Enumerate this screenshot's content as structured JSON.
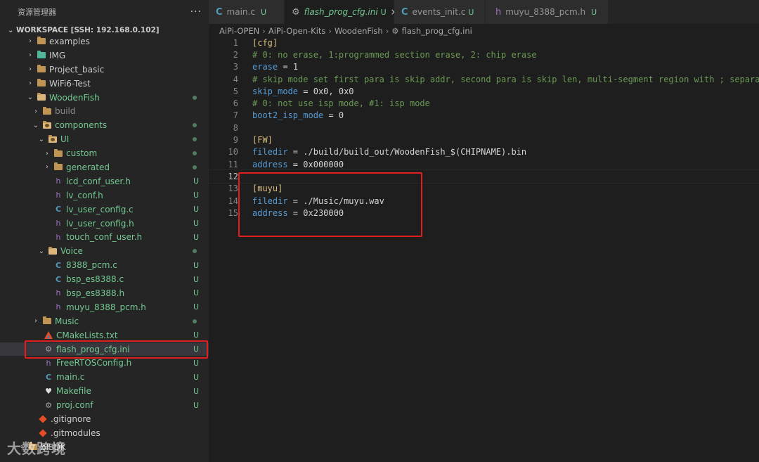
{
  "sidebar": {
    "title": "资源管理器",
    "more": "···",
    "workspace": "WORKSPACE [SSH: 192.168.0.102]",
    "items": [
      {
        "label": "examples",
        "status": ""
      },
      {
        "label": "IMG",
        "status": ""
      },
      {
        "label": "Project_basic",
        "status": ""
      },
      {
        "label": "WiFi6-Test",
        "status": ""
      },
      {
        "label": "WoodenFish",
        "status": ""
      },
      {
        "label": "build",
        "status": ""
      },
      {
        "label": "components",
        "status": ""
      },
      {
        "label": "UI",
        "status": ""
      },
      {
        "label": "custom",
        "status": ""
      },
      {
        "label": "generated",
        "status": ""
      },
      {
        "label": "lcd_conf_user.h",
        "status": "U"
      },
      {
        "label": "lv_conf.h",
        "status": "U"
      },
      {
        "label": "lv_user_config.c",
        "status": "U"
      },
      {
        "label": "lv_user_config.h",
        "status": "U"
      },
      {
        "label": "touch_conf_user.h",
        "status": "U"
      },
      {
        "label": "Voice",
        "status": ""
      },
      {
        "label": "8388_pcm.c",
        "status": "U"
      },
      {
        "label": "bsp_es8388.c",
        "status": "U"
      },
      {
        "label": "bsp_es8388.h",
        "status": "U"
      },
      {
        "label": "muyu_8388_pcm.h",
        "status": "U"
      },
      {
        "label": "Music",
        "status": ""
      },
      {
        "label": "CMakeLists.txt",
        "status": "U"
      },
      {
        "label": "flash_prog_cfg.ini",
        "status": "U"
      },
      {
        "label": "FreeRTOSConfig.h",
        "status": "U"
      },
      {
        "label": "main.c",
        "status": "U"
      },
      {
        "label": "Makefile",
        "status": "U"
      },
      {
        "label": "proj.conf",
        "status": "U"
      },
      {
        "label": ".gitignore",
        "status": ""
      },
      {
        "label": ".gitmodules",
        "status": ""
      },
      {
        "label": "blSDK",
        "status": ""
      }
    ],
    "watermark": "大数跨境"
  },
  "tabs": [
    {
      "label": "main.c",
      "status": "U"
    },
    {
      "label": "flash_prog_cfg.ini",
      "status": "U",
      "close": "×"
    },
    {
      "label": "events_init.c",
      "status": "U"
    },
    {
      "label": "muyu_8388_pcm.h",
      "status": "U"
    }
  ],
  "breadcrumb": [
    "AiPi-OPEN",
    "AiPi-Open-Kits",
    "WoodenFish",
    "flash_prog_cfg.ini"
  ],
  "code": {
    "l1": "[cfg]",
    "l2": "# 0: no erase, 1:programmed section erase, 2: chip erase",
    "l3k": "erase",
    "l3v": "1",
    "l4": "# skip mode set first para is skip addr, second para is skip len, multi-segment region with ; separated",
    "l5k": "skip_mode",
    "l5v": "0x0, 0x0",
    "l6": "# 0: not use isp mode, #1: isp mode",
    "l7k": "boot2_isp_mode",
    "l7v": "0",
    "l9": "[FW]",
    "l10k": "filedir",
    "l10v": "./build/build_out/WoodenFish_$(CHIPNAME).bin",
    "l11k": "address",
    "l11v": "0x000000",
    "l13": "[muyu]",
    "l14k": "filedir",
    "l14v": "./Music/muyu.wav",
    "l15k": "address",
    "l15v": "0x230000",
    "eq": " = "
  },
  "line_numbers": [
    "1",
    "2",
    "3",
    "4",
    "5",
    "6",
    "7",
    "8",
    "9",
    "10",
    "11",
    "12",
    "13",
    "14",
    "15"
  ]
}
